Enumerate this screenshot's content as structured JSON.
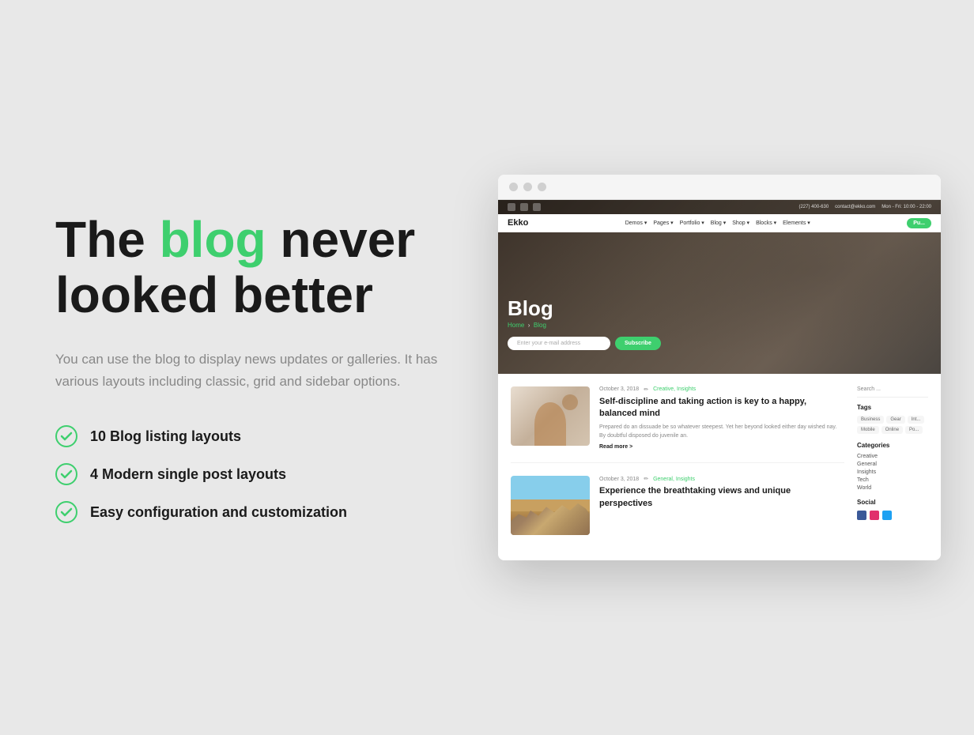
{
  "page": {
    "background": "#e8e8e8"
  },
  "left": {
    "headline_part1": "The ",
    "headline_green": "blog",
    "headline_part2": " never",
    "headline_line2": "looked better",
    "subtitle": "You can use the blog to display news updates or galleries. It has various layouts including classic, grid and sidebar options.",
    "features": [
      {
        "id": "f1",
        "text": "10 Blog listing layouts"
      },
      {
        "id": "f2",
        "text": "4 Modern single post layouts"
      },
      {
        "id": "f3",
        "text": "Easy configuration and customization"
      }
    ]
  },
  "browser": {
    "topbar": {
      "phone": "(227) 400-630",
      "email": "contact@ekko.com",
      "hours": "Mon - Fri: 10:00 - 22:00"
    },
    "navbar": {
      "brand": "Ekko",
      "links": [
        "Demos",
        "Pages",
        "Portfolio",
        "Blog",
        "Shop",
        "Blocks",
        "Elements"
      ],
      "cta": "Pu..."
    },
    "hero": {
      "title": "Blog",
      "breadcrumb_home": "Home",
      "breadcrumb_current": "Blog",
      "email_placeholder": "Enter your e-mail address",
      "subscribe_btn": "Subscribe"
    },
    "posts": [
      {
        "id": "post-1",
        "date": "October 3, 2018",
        "tags": "Creative, Insights",
        "title": "Self-discipline and taking action is key to a happy, balanced mind",
        "excerpt": "Prepared do an dissuade be so whatever steepest. Yet her beyond looked either day wished nay. By doubtful disposed do juvenile an.",
        "read_more": "Read more >"
      },
      {
        "id": "post-2",
        "date": "October 3, 2018",
        "tags": "General, Insights",
        "title": "Experience the breathtaking views and unique perspectives",
        "excerpt": "",
        "read_more": ""
      }
    ],
    "sidebar": {
      "search_placeholder": "Search ...",
      "tags_label": "Tags",
      "tags": [
        "Business",
        "Gear",
        "Int...",
        "Mobile",
        "Online",
        "Po..."
      ],
      "categories_label": "Categories",
      "categories": [
        "Creative",
        "General",
        "Insights",
        "Tech",
        "World"
      ],
      "social_label": "Social"
    }
  }
}
